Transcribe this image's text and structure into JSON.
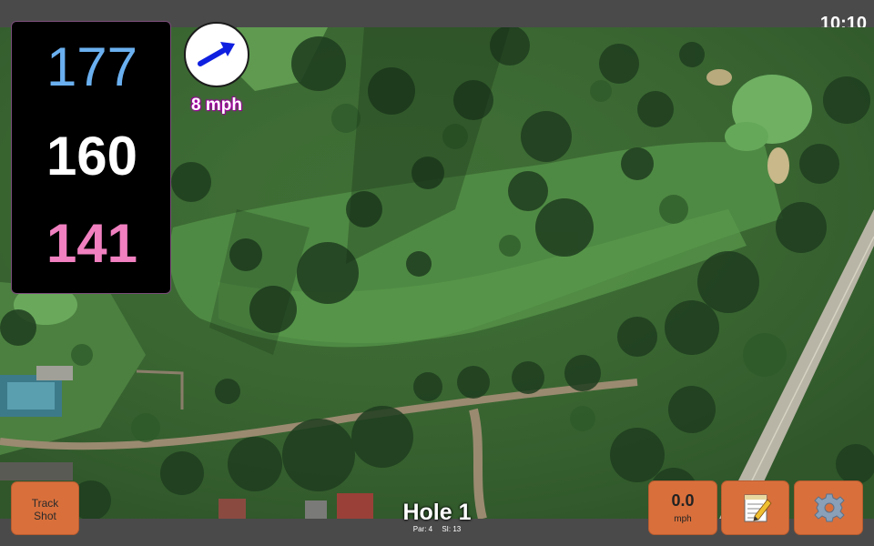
{
  "status": {
    "time": "10:10"
  },
  "distances": {
    "back": "177",
    "middle": "160",
    "front": "141",
    "colors": {
      "back": "#6ab0f0",
      "middle": "#ffffff",
      "front": "#f080c0"
    }
  },
  "wind": {
    "speed_label": "8 mph",
    "arrow_icon": "wind-direction-arrow-icon",
    "arrow_color": "#1020e0"
  },
  "buttons": {
    "track_shot_line1": "Track",
    "track_shot_line2": "Shot",
    "speed_value": "0.0",
    "speed_unit": "mph",
    "notes_icon": "notepad-icon",
    "settings_icon": "gear-icon",
    "accent_color": "#d9703c"
  },
  "hole": {
    "title": "Hole 1",
    "par": "Par: 4",
    "stroke_index": "SI: 13"
  },
  "map": {
    "view": "satellite golf course aerial"
  }
}
